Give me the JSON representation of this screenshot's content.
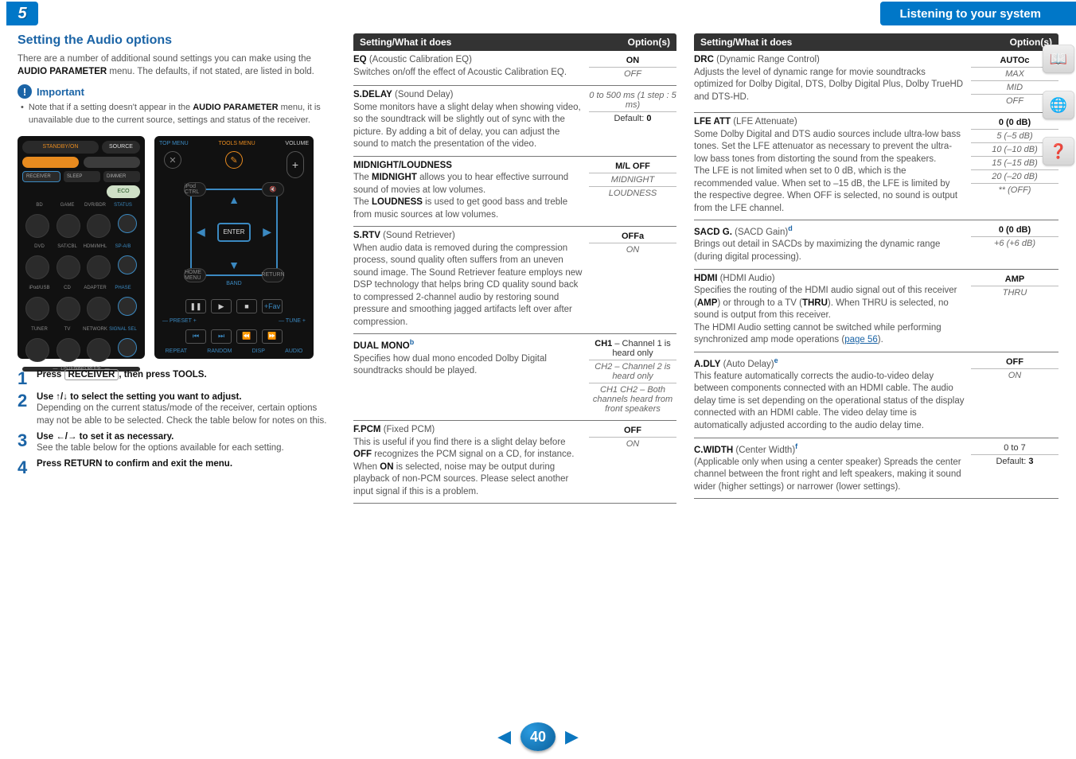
{
  "top": {
    "chapter": "5",
    "title": "Listening to your system"
  },
  "left": {
    "heading": "Setting the Audio options",
    "intro": "There are a number of additional sound settings you can make using the AUDIO PARAMETER menu. The defaults, if not stated, are listed in bold.",
    "intro_bold": "AUDIO PARAMETER",
    "imp_label": "Important",
    "imp_text_a": "Note that if a setting doesn't appear in the ",
    "imp_bold1": "AUDIO PARAMETER",
    "imp_text_b": " menu, it is unavailable due to the current source, settings and status of the receiver.",
    "steps": [
      {
        "n": "1",
        "title_a": "Press ",
        "title_btn": "RECEIVER",
        "title_b": ", then press TOOLS.",
        "body": ""
      },
      {
        "n": "2",
        "title_a": "Use ↑/↓ to select the setting you want to adjust.",
        "title_btn": "",
        "title_b": "",
        "body": "Depending on the current status/mode of the receiver, certain options may not be able to be selected. Check the table below for notes on this."
      },
      {
        "n": "3",
        "title_a": "Use ←/→ to set it as necessary.",
        "title_btn": "",
        "title_b": "",
        "body": "See the table below for the options available for each setting."
      },
      {
        "n": "4",
        "title_a": "Press RETURN to confirm and exit the menu.",
        "title_btn": "",
        "title_b": "",
        "body": ""
      }
    ],
    "remote": {
      "standby": "STANDBY/ON",
      "source": "SOURCE",
      "receiver": "RECEIVER",
      "sleep": "SLEEP",
      "dimmer": "DIMMER",
      "eco": "ECO",
      "row1": [
        "BD",
        "GAME",
        "DVR/BDR",
        "STATUS"
      ],
      "row2": [
        "DVD",
        "SAT/CBL",
        "HDMI/MHL",
        "SP-A/B"
      ],
      "row3": [
        "iPod/USB",
        "CD",
        "ADAPTER",
        "PHASE"
      ],
      "row4": [
        "TUNER",
        "TV",
        "NETWORK",
        "SIGNAL SEL"
      ],
      "listen": "LISTENING MODE"
    },
    "remote2": {
      "top": "TOP MENU",
      "tools": "TOOLS MENU",
      "vol": "VOLUME",
      "enter": "ENTER",
      "home": "HOME MENU",
      "return": "RETURN",
      "band": "BAND",
      "preset": "— PRESET +",
      "tune": "— TUNE +",
      "fav": "+Fav",
      "bot": [
        "REPEAT",
        "RANDOM",
        "DISP",
        "AUDIO"
      ]
    }
  },
  "col2": {
    "header_l": "Setting/What it does",
    "header_r": "Option(s)",
    "rows": [
      {
        "h": "EQ",
        "hsuf": " (Acoustic Calibration EQ)",
        "body": "Switches on/off the effect of Acoustic Calibration EQ.",
        "opts": [
          {
            "t": "ON",
            "b": true
          },
          {
            "t": "OFF",
            "i": true
          }
        ]
      },
      {
        "h": "S.DELAY",
        "hsuf": " (Sound Delay)",
        "body": "Some monitors have a slight delay when showing video, so the soundtrack will be slightly out of sync with the picture. By adding a bit of delay, you can adjust the sound to match the presentation of the video.",
        "opts": [
          {
            "t": "0 to 500 ms (1 step : 5 ms)",
            "i": true
          },
          {
            "t": "Default: 0",
            "plain": true,
            "zero": true
          }
        ]
      },
      {
        "h": "MIDNIGHT/LOUDNESS",
        "body": "The MIDNIGHT allows you to hear effective surround sound of movies at low volumes.\nThe LOUDNESS is used to get good bass and treble from music sources at low volumes.",
        "bodybold": [
          "MIDNIGHT",
          "LOUDNESS"
        ],
        "opts": [
          {
            "t": "M/L OFF",
            "b": true
          },
          {
            "t": "MIDNIGHT",
            "i": true
          },
          {
            "t": "LOUDNESS",
            "i": true
          }
        ]
      },
      {
        "h": "S.RTV",
        "hsuf": " (Sound Retriever)",
        "body": "When audio data is removed during the compression process, sound quality often suffers from an uneven sound image. The Sound Retriever feature employs new DSP technology that helps bring CD quality sound back to compressed 2-channel audio by restoring sound pressure and smoothing jagged artifacts left over after compression.",
        "opts": [
          {
            "t": "OFF",
            "b": true,
            "sup": "a"
          },
          {
            "t": "ON",
            "i": true
          }
        ]
      },
      {
        "h": "DUAL MONO",
        "sup": "b",
        "body": "Specifies how dual mono encoded Dolby Digital soundtracks should be played.",
        "opts": [
          {
            "t": "CH1 – Channel 1 is heard only",
            "mix": true,
            "mixb": "CH1"
          },
          {
            "t": "CH2 – Channel 2 is heard only",
            "i": true
          },
          {
            "t": "CH1 CH2 – Both channels heard from front speakers",
            "i": true
          }
        ]
      },
      {
        "h": "F.PCM",
        "hsuf": " (Fixed PCM)",
        "body": "This is useful if you find there is a slight delay before OFF recognizes the PCM signal on a CD, for instance.\nWhen ON is selected, noise may be output during playback of non-PCM sources. Please select another input signal if this is a problem.",
        "bodybold": [
          "OFF",
          "ON"
        ],
        "opts": [
          {
            "t": "OFF",
            "b": true
          },
          {
            "t": "ON",
            "i": true
          }
        ]
      }
    ]
  },
  "col3": {
    "header_l": "Setting/What it does",
    "header_r": "Option(s)",
    "rows": [
      {
        "h": "DRC",
        "hsuf": " (Dynamic Range Control)",
        "body": "Adjusts the level of dynamic range for movie soundtracks optimized for Dolby Digital, DTS, Dolby Digital Plus, Dolby TrueHD and DTS-HD.",
        "opts": [
          {
            "t": "AUTO",
            "b": true,
            "sup": "c"
          },
          {
            "t": "MAX",
            "i": true
          },
          {
            "t": "MID",
            "i": true
          },
          {
            "t": "OFF",
            "i": true
          }
        ]
      },
      {
        "h": "LFE ATT",
        "hsuf": " (LFE Attenuate)",
        "body": "Some Dolby Digital and DTS audio sources include ultra-low bass tones. Set the LFE attenuator as necessary to prevent the ultra-low bass tones from distorting the sound from the speakers.\nThe LFE is not limited when set to 0 dB, which is the recommended value. When set to –15 dB, the LFE is limited by the respective degree. When OFF is selected, no sound is output from the LFE channel.",
        "opts": [
          {
            "t": "0 (0 dB)",
            "b": true,
            "mixz": true
          },
          {
            "t": "5 (–5 dB)",
            "i": true
          },
          {
            "t": "10 (–10 dB)",
            "i": true
          },
          {
            "t": "15 (–15 dB)",
            "i": true
          },
          {
            "t": "20 (–20 dB)",
            "i": true
          },
          {
            "t": "** (OFF)",
            "i": true
          }
        ]
      },
      {
        "h": "SACD G.",
        "hsuf": " (SACD Gain)",
        "sup": "d",
        "body": "Brings out detail in SACDs by maximizing the dynamic range (during digital processing).",
        "opts": [
          {
            "t": "0 (0 dB)",
            "b": true,
            "mixz": true
          },
          {
            "t": "+6 (+6 dB)",
            "i": true
          }
        ]
      },
      {
        "h": "HDMI",
        "hsuf": " (HDMI Audio)",
        "body": "Specifies the routing of the HDMI audio signal out of this receiver (AMP) or through to a TV (THRU). When THRU is selected, no sound is output from this receiver.\nThe HDMI Audio setting cannot be switched while performing synchronized amp mode operations (",
        "bodybold": [
          "AMP",
          "THRU",
          "THRU"
        ],
        "link": "page 56",
        "tail": ").",
        "opts": [
          {
            "t": "AMP",
            "b": true
          },
          {
            "t": "THRU",
            "i": true
          }
        ]
      },
      {
        "h": "A.DLY",
        "hsuf": " (Auto Delay)",
        "sup": "e",
        "body": "This feature automatically corrects the audio-to-video delay between components connected with an HDMI cable. The audio delay time is set depending on the operational status of the display connected with an HDMI cable. The video delay time is automatically adjusted according to the audio delay time.",
        "opts": [
          {
            "t": "OFF",
            "b": true
          },
          {
            "t": "ON",
            "i": true
          }
        ]
      },
      {
        "h": "C.WIDTH",
        "hsuf": " (Center Width)",
        "sup": "f",
        "body": "(Applicable only when using a center speaker) Spreads the center channel between the front right and left speakers, making it sound wider (higher settings) or narrower (lower settings).",
        "opts": [
          {
            "t": "0 to 7",
            "plain": true
          },
          {
            "t": "Default: 3",
            "plain": true,
            "three": true
          }
        ]
      }
    ]
  },
  "footer": {
    "page": "40"
  }
}
